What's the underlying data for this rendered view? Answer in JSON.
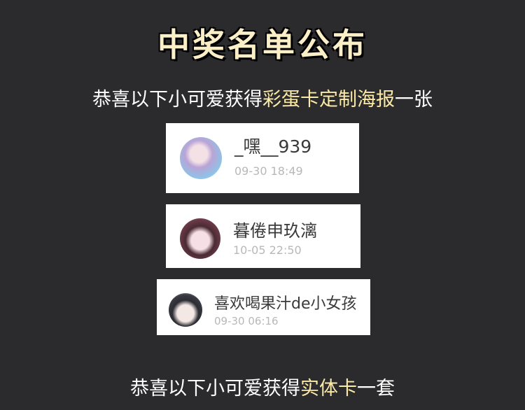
{
  "title": "中奖名单公布",
  "announcement1": {
    "prefix": "恭喜以下小可爱获得",
    "prize": "彩蛋卡定制海报",
    "suffix": "一张"
  },
  "winners": [
    {
      "name": "_嘿__939",
      "time": "09-30 18:49"
    },
    {
      "name": "暮倦申玖漓",
      "time": "10-05 22:50"
    },
    {
      "name": "喜欢喝果汁de小女孩",
      "time": "09-30 06:16"
    }
  ],
  "announcement2": {
    "prefix": "恭喜以下小可爱获得",
    "prize": "实体卡",
    "suffix": "一套"
  },
  "colors": {
    "background": "#2b2b2d",
    "highlight": "#fbe9a8",
    "title": "#fbefc8"
  }
}
